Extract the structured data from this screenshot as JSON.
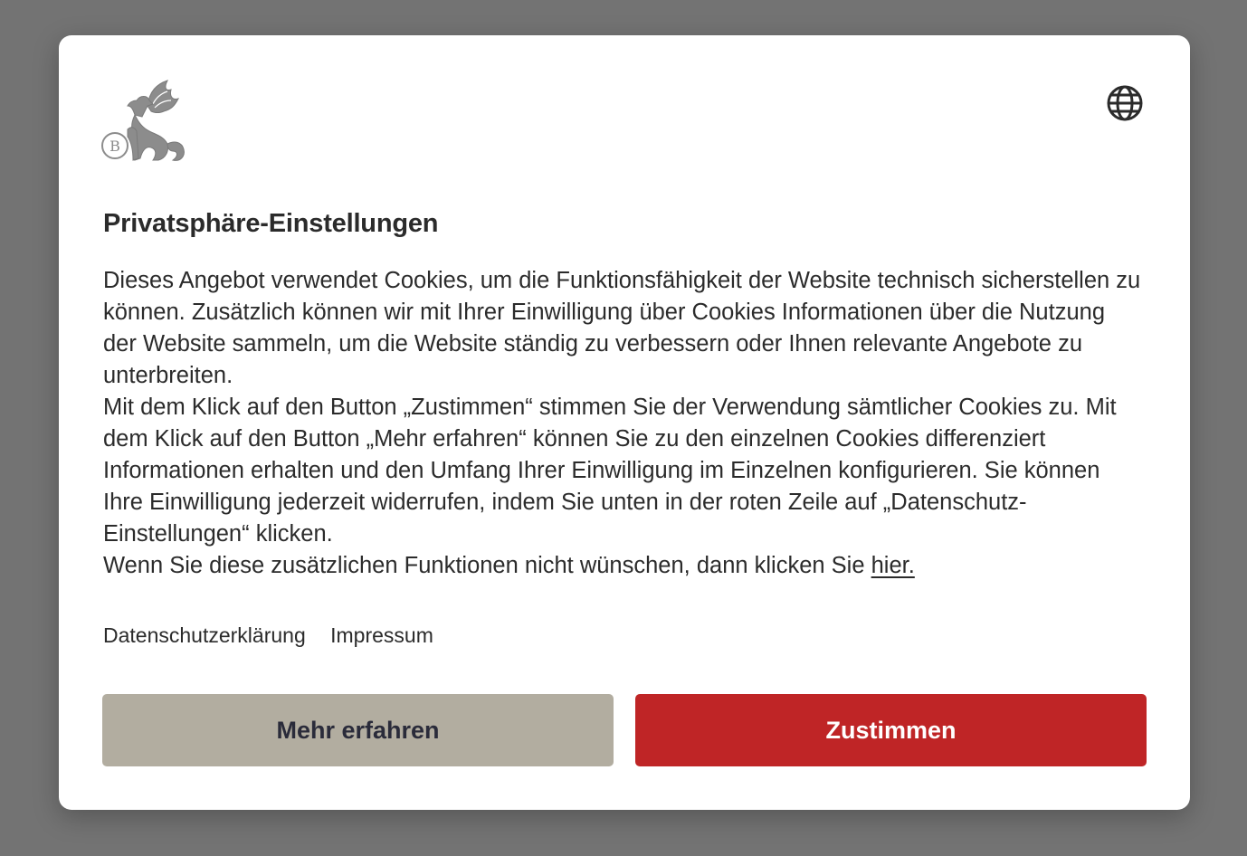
{
  "dialog": {
    "title": "Privatsphäre-Einstellungen",
    "paragraph_1": "Dieses Angebot verwendet Cookies, um die Funktionsfähigkeit der Website technisch sicherstellen zu können. Zusätzlich können wir mit Ihrer Einwilligung über Cookies Informationen über die Nutzung der Website sammeln, um die Website ständig zu verbessern oder Ihnen relevante Angebote zu unterbreiten.",
    "paragraph_2": "Mit dem Klick auf den Button „Zustimmen“ stimmen Sie der Verwendung sämtlicher Cookies zu. Mit dem Klick auf den Button „Mehr erfahren“ können Sie zu den einzelnen Cookies differenziert Informationen erhalten und den Umfang Ihrer Einwilligung im Einzelnen konfigurieren. Sie können Ihre Einwilligung jederzeit widerrufen, indem Sie unten in der roten Zeile auf „Datenschutz-Einstellungen“ klicken.",
    "paragraph_3": "Wenn Sie diese zusätzlichen Funktionen nicht wünschen, dann klicken Sie ",
    "paragraph_3_link": "hier.",
    "links": {
      "privacy": "Datenschutzerklärung",
      "imprint": "Impressum"
    },
    "buttons": {
      "more": "Mehr erfahren",
      "accept": "Zustimmen"
    },
    "logo_letter": "B",
    "icons": {
      "language": "globe-icon",
      "logo": "griffin-logo"
    }
  },
  "colors": {
    "overlay": "#737373",
    "accept_button": "#bf2526",
    "more_button": "#b2ada0",
    "text": "#2b2b2b"
  }
}
